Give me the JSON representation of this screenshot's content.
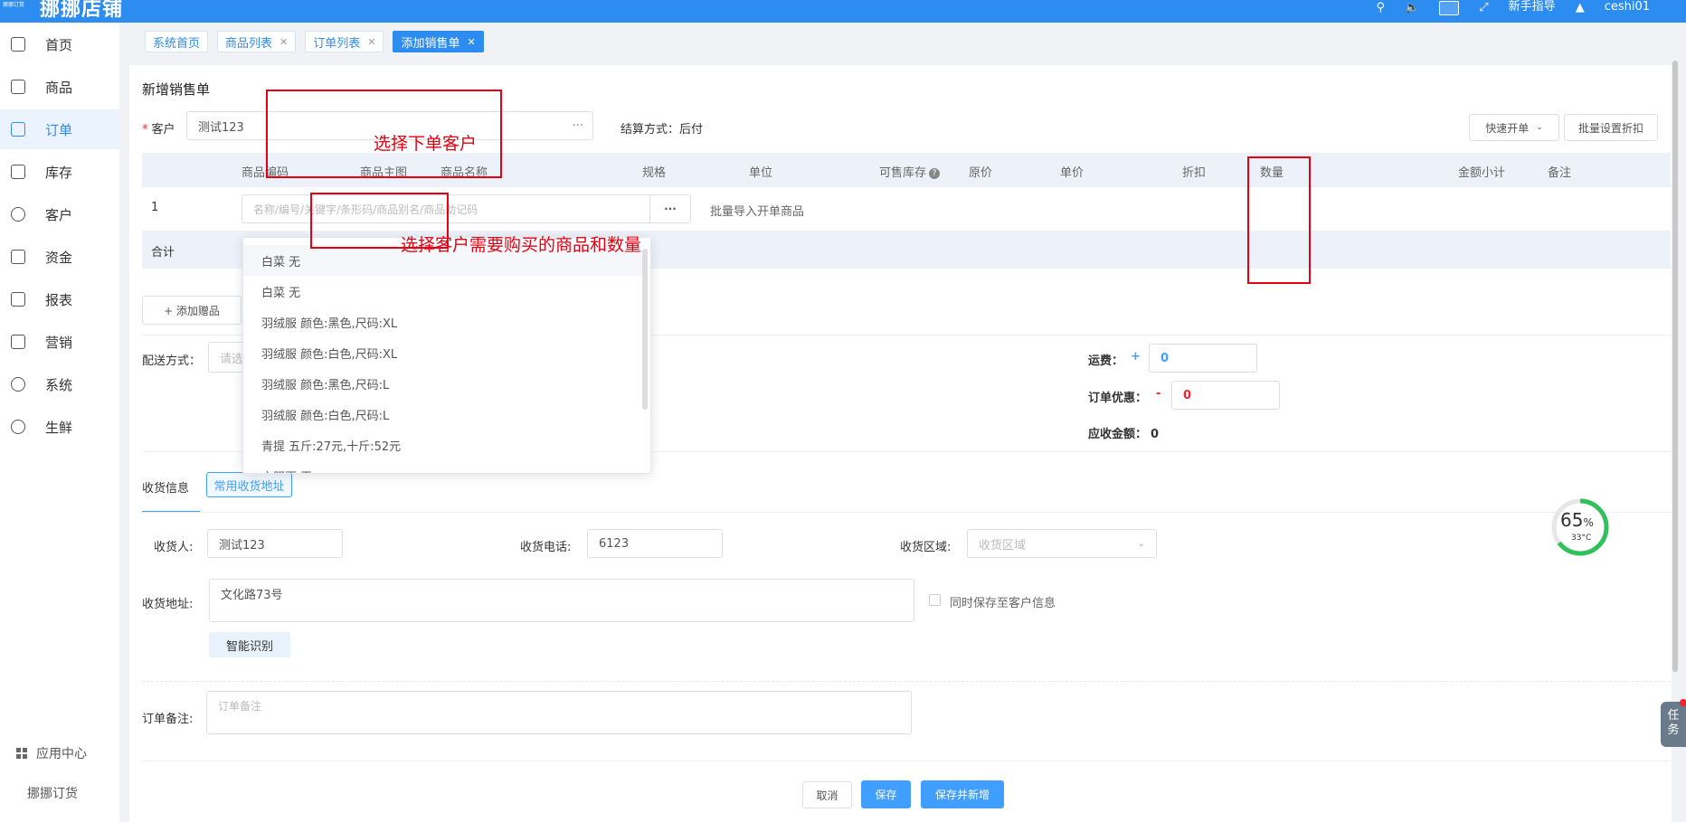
{
  "app": {
    "logo_text": "挪挪订货",
    "brand": "挪挪店铺",
    "user": "ceshi01",
    "guide": "新手指导"
  },
  "sidebar": {
    "items": [
      {
        "label": "首页",
        "icon": "home-icon"
      },
      {
        "label": "商品",
        "icon": "bag-icon"
      },
      {
        "label": "订单",
        "icon": "document-icon"
      },
      {
        "label": "库存",
        "icon": "store-icon"
      },
      {
        "label": "客户",
        "icon": "user-icon"
      },
      {
        "label": "资金",
        "icon": "wallet-icon"
      },
      {
        "label": "报表",
        "icon": "chart-icon"
      },
      {
        "label": "营销",
        "icon": "gift-icon"
      },
      {
        "label": "系统",
        "icon": "gear-icon"
      },
      {
        "label": "生鲜",
        "icon": "bowl-icon"
      }
    ],
    "active_index": 2,
    "app_center": "应用中心",
    "app_sub": "挪挪订货"
  },
  "tabs": [
    {
      "label": "系统首页",
      "closable": false
    },
    {
      "label": "商品列表",
      "closable": true
    },
    {
      "label": "订单列表",
      "closable": true
    },
    {
      "label": "添加销售单",
      "closable": true,
      "active": true
    }
  ],
  "form": {
    "title": "新增销售单",
    "customer_label": "客户",
    "customer_value": "测试123",
    "settle_label": "结算方式：",
    "settle_value": "后付",
    "quick_btn": "快速开单",
    "batch_discount_btn": "批量设置折扣"
  },
  "table": {
    "headers": [
      "商品编码",
      "商品主图",
      "商品名称",
      "规格",
      "单位",
      "可售库存",
      "原价",
      "单价",
      "折扣",
      "数量",
      "金额小计",
      "备注"
    ],
    "row_index": "1",
    "search_placeholder": "名称/编号/关键字/条形码/商品别名/商品助记码",
    "more": "···",
    "batch_import": "批量导入开单商品",
    "total_label": "合计"
  },
  "dropdown": {
    "items": [
      "白菜 无",
      "白菜 无",
      "羽绒服 颜色:黑色,尺码:XL",
      "羽绒服 颜色:白色,尺码:XL",
      "羽绒服 颜色:黑色,尺码:L",
      "羽绒服 颜色:白色,尺码:L",
      "青提 五斤:27元,十斤:52元",
      "衣服更 无"
    ]
  },
  "gift": {
    "label": "+ 添加赠品"
  },
  "delivery": {
    "label": "配送方式：",
    "placeholder": "请选"
  },
  "fees": {
    "freight_label": "运费：",
    "freight_sign": "+",
    "freight_value": "0",
    "discount_label": "订单优惠：",
    "discount_sign": "-",
    "discount_value": "0",
    "receivable_label": "应收金额：",
    "receivable_value": "0"
  },
  "receiver": {
    "tab_info": "收货信息",
    "tab_common": "常用收货地址",
    "name_label": "收货人:",
    "name_value": "测试123",
    "phone_label": "收货电话:",
    "phone_value": "6123",
    "area_label": "收货区域:",
    "area_placeholder": "收货区域",
    "addr_label": "收货地址:",
    "addr_value": "文化路73号",
    "save_to_customer": "同时保存至客户信息",
    "smart_btn": "智能识别"
  },
  "remark": {
    "label": "订单备注:",
    "placeholder": "订单备注"
  },
  "actions": {
    "cancel": "取消",
    "save": "保存",
    "save_new": "保存并新增"
  },
  "annotations": {
    "customer_note": "选择下单客户",
    "product_note": "选择客户需要购买的商品和数量"
  },
  "widget": {
    "percent": "65",
    "percent_unit": "%",
    "temp": "33°C",
    "task": "任务"
  },
  "colors": {
    "primary": "#2d8cf0",
    "button": "#409eff",
    "annotation": "#e60012"
  }
}
